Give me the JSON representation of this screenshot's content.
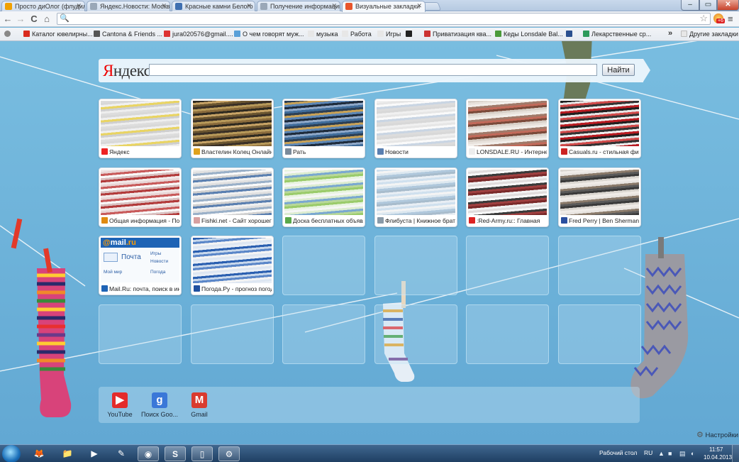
{
  "tabs": [
    {
      "title": "Просто диОлог (флудил",
      "icon_color": "#f0a000"
    },
    {
      "title": "Яндекс.Новости: Москва",
      "icon_color": "#9aa8b8"
    },
    {
      "title": "Красные камни Белого (",
      "icon_color": "#3f6fb0"
    },
    {
      "title": "Получение информации",
      "icon_color": "#9aa8b8"
    },
    {
      "title": "Визуальные закладки",
      "icon_color": "#e8552b"
    }
  ],
  "window": {
    "minimize": "–",
    "maximize": "▭",
    "close": "✕"
  },
  "toolbar": {
    "back": "←",
    "forward": "→",
    "reload": "C",
    "home": "⌂",
    "search_glyph": "🔍",
    "star": "☆",
    "ext_badge": "+6",
    "menu": "≡"
  },
  "bookmarks": {
    "items": [
      {
        "label": "",
        "color": "#888"
      },
      {
        "label": "Каталог ювелирны...",
        "color": "#d92b1e"
      },
      {
        "label": "Cantona & Friends ...",
        "color": "#555"
      },
      {
        "label": "jura020576@gmail....",
        "color": "#d33"
      },
      {
        "label": "О чем говорят муж...",
        "color": "#5aa0d8"
      },
      {
        "label": "музыка",
        "color": "#e7e7e7"
      },
      {
        "label": "Работа",
        "color": "#e7e7e7"
      },
      {
        "label": "Игры",
        "color": "#e7e7e7"
      },
      {
        "label": "",
        "color": "#222"
      },
      {
        "label": "Приватизация ква...",
        "color": "#c33"
      },
      {
        "label": "Кеды Lonsdale Bal...",
        "color": "#4a9a3a"
      },
      {
        "label": "",
        "color": "#2a4f8f"
      },
      {
        "label": "Лекарственные ср...",
        "color": "#2d9a5a"
      }
    ],
    "more": "»",
    "other": "Другие закладки"
  },
  "search": {
    "logo_first": "Я",
    "logo_rest": "ндекс",
    "value": "",
    "button": "Найти"
  },
  "tiles": [
    {
      "title": "Яндекс",
      "icon_color": "#e22",
      "thumb": [
        "#ddd",
        "#eee",
        "#d8d8d8",
        "#e9d463",
        "#f0f0f0",
        "#cfcfcf"
      ]
    },
    {
      "title": "Властелин Колец Онлайн | ...",
      "icon_color": "#e0a21d",
      "thumb": [
        "#2f2a20",
        "#8a6b3c",
        "#c7a366",
        "#3a3026",
        "#6a5530",
        "#b89a5a"
      ]
    },
    {
      "title": "Рать",
      "icon_color": "#7a8a9a",
      "thumb": [
        "#2c3f55",
        "#3f6c9a",
        "#c9a256",
        "#1e2b3b",
        "#5c86b5",
        "#8fa8c8"
      ]
    },
    {
      "title": "Новости",
      "icon_color": "#5a7fb0",
      "thumb": [
        "#f0f0f0",
        "#d8d8d8",
        "#e6e6e6",
        "#c9d5e3",
        "#fafafa",
        "#dcdcdc"
      ]
    },
    {
      "title": "LONSDALE.RU - Интернет ...",
      "icon_color": "#eee",
      "thumb": [
        "#d8d0c8",
        "#7a4a3a",
        "#e8e2dc",
        "#a07a6a",
        "#f2eeea",
        "#c26a5a"
      ]
    },
    {
      "title": "Casuals.ru - стильная фир...",
      "icon_color": "#c22",
      "thumb": [
        "#1f1f1f",
        "#b81c22",
        "#e6e6e6",
        "#333",
        "#d04a4a",
        "#f0f0f0"
      ]
    },
    {
      "title": "Общая информация - Порт...",
      "icon_color": "#e08a10",
      "thumb": [
        "#f2e9e9",
        "#b23a3a",
        "#e8d5d5",
        "#fafafa",
        "#c85a5a",
        "#d9c0c0"
      ]
    },
    {
      "title": "Fishki.net - Сайт хорошего ...",
      "icon_color": "#d8a0a0",
      "thumb": [
        "#f0f0f0",
        "#5a7fb0",
        "#e0e0e0",
        "#fafafa",
        "#9ab0c8",
        "#d0d0d0"
      ]
    },
    {
      "title": "Доска бесплатных объявл...",
      "icon_color": "#5aa84a",
      "thumb": [
        "#e8f4e0",
        "#9acb6a",
        "#f6f6f6",
        "#7aa8d0",
        "#dcecd0",
        "#b8d898"
      ]
    },
    {
      "title": "Флибуста | Книжное братство",
      "icon_color": "#8a9aa8",
      "thumb": [
        "#cfe0ee",
        "#e8eef4",
        "#f4f4f4",
        "#b0c8dc",
        "#dde8f0",
        "#a8bccc"
      ]
    },
    {
      "title": ":Red-Army.ru:: Главная",
      "icon_color": "#d22",
      "thumb": [
        "#f2f2f2",
        "#7a2a2a",
        "#e0dcdc",
        "#3a3a3a",
        "#f8f8f8",
        "#a04040"
      ]
    },
    {
      "title": "Fred Perry | Ben Sherman | ...",
      "icon_color": "#2a4f9f",
      "thumb": [
        "#dcd8d2",
        "#3a3a3a",
        "#f0ece8",
        "#8a7a6a",
        "#e8e4e0",
        "#5a5a5a"
      ]
    },
    {
      "title": "Mail.Ru: почта, поиск в инт...",
      "icon_color": "#1e63b5",
      "mail": true
    },
    {
      "title": "Погода.Ру - прогноз погоды",
      "icon_color": "#1f4f9f",
      "thumb": [
        "#2a5fb0",
        "#e8eef6",
        "#c8d8ec",
        "#f4f4f4",
        "#5a86c8",
        "#dde6f2"
      ]
    }
  ],
  "mail": {
    "logo_at": "@",
    "logo_text": "mail",
    "logo_ru": ".ru",
    "pochta": "Почта",
    "items": [
      "Игры",
      "Новости",
      "Мой мир",
      "Погода"
    ]
  },
  "apps": [
    {
      "label": "YouTube",
      "glyph": "▶",
      "color": "#e32b2b"
    },
    {
      "label": "Поиск Goo...",
      "glyph": "g",
      "color": "#3a78d8"
    },
    {
      "label": "Gmail",
      "glyph": "M",
      "color": "#d93b2f"
    }
  ],
  "settings": {
    "label": "Настройки",
    "icon": "⚙"
  },
  "taskbar": {
    "items": [
      {
        "glyph": "🦊",
        "open": false
      },
      {
        "glyph": "📁",
        "open": false
      },
      {
        "glyph": "▶",
        "open": false
      },
      {
        "glyph": "✎",
        "open": false
      },
      {
        "glyph": "◉",
        "open": true
      },
      {
        "glyph": "S",
        "open": true
      },
      {
        "glyph": "▯",
        "open": true
      },
      {
        "glyph": "⚙",
        "open": true
      }
    ],
    "desktop_label": "Рабочий стол",
    "lang": "RU",
    "time": "11:57",
    "date": "10.04.2013"
  }
}
